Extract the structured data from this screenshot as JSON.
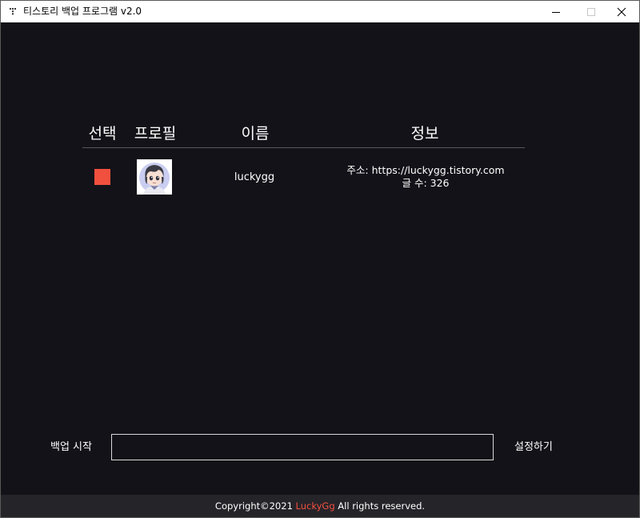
{
  "window": {
    "title": "티스토리 백업 프로그램 v2.0",
    "icon": "tistory-logo-icon"
  },
  "table": {
    "headers": {
      "select": "선택",
      "profile": "프로필",
      "name": "이름",
      "info": "정보"
    },
    "rows": [
      {
        "selected": true,
        "avatar": "anime-avatar",
        "name": "luckygg",
        "address": "주소: https://luckygg.tistory.com",
        "post_count": "글 수: 326"
      }
    ]
  },
  "controls": {
    "start_label": "백업 시작",
    "progress": 0,
    "settings_label": "설정하기"
  },
  "footer": {
    "prefix": "Copyright©2021 ",
    "brand": "LuckyGg",
    "suffix": " All rights reserved."
  },
  "colors": {
    "background": "#131218",
    "accent": "#f2503f",
    "footer_bg": "#252429",
    "text": "#ffffff"
  }
}
